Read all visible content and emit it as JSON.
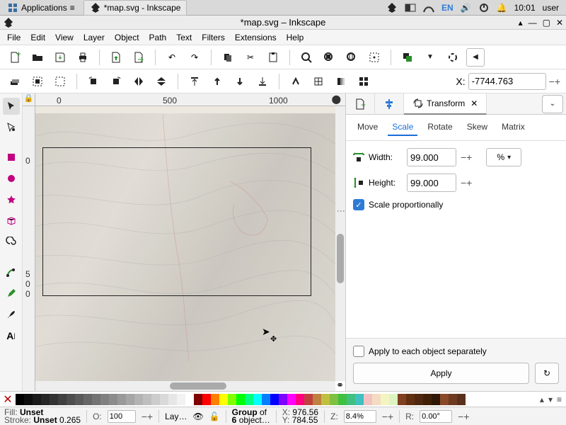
{
  "system": {
    "app_menu": "Applications",
    "taskbar_title": "*map.svg - Inkscape",
    "lang": "EN",
    "clock": "10:01",
    "user": "user"
  },
  "window": {
    "title": "*map.svg – Inkscape"
  },
  "menus": [
    "File",
    "Edit",
    "View",
    "Layer",
    "Object",
    "Path",
    "Text",
    "Filters",
    "Extensions",
    "Help"
  ],
  "coord": {
    "label": "X:",
    "value": "-7744.763"
  },
  "ruler_h": {
    "t0": "0",
    "t500": "500",
    "t1000": "1000"
  },
  "ruler_v": {
    "t0": "0",
    "t5": "5\n0\n0"
  },
  "dock": {
    "tab_transform": "Transform",
    "tabs": {
      "move": "Move",
      "scale": "Scale",
      "rotate": "Rotate",
      "skew": "Skew",
      "matrix": "Matrix"
    },
    "width_label": "Width:",
    "height_label": "Height:",
    "width_value": "99.000",
    "height_value": "99.000",
    "unit": "%",
    "scale_prop": "Scale proportionally",
    "apply_each": "Apply to each object separately",
    "apply": "Apply"
  },
  "status": {
    "fill_label": "Fill:",
    "stroke_label": "Stroke:",
    "unset": "Unset",
    "stroke_w": "0.265",
    "o_label": "O:",
    "opacity": "100",
    "layer_label": "Lay…",
    "sel1": "Group",
    "sel_of": "of",
    "sel2": "6",
    "sel_obj": "object…",
    "xl": "X:",
    "yl": "Y:",
    "xv": "976.56",
    "yv": "784.55",
    "zl": "Z:",
    "zv": "8.4%",
    "rl": "R:",
    "rv": "0.00°"
  },
  "palette_grays": [
    "#000",
    "#0d0d0d",
    "#1a1a1a",
    "#262626",
    "#333",
    "#404040",
    "#4d4d4d",
    "#595959",
    "#666",
    "#737373",
    "#808080",
    "#8c8c8c",
    "#999",
    "#a6a6a6",
    "#b3b3b3",
    "#bfbfbf",
    "#ccc",
    "#d9d9d9",
    "#e6e6e6",
    "#f2f2f2",
    "#fff"
  ],
  "palette_colors": [
    "#800000",
    "#f00",
    "#ff8000",
    "#ff0",
    "#80ff00",
    "#0f0",
    "#00ff80",
    "#0ff",
    "#0080ff",
    "#00f",
    "#8000ff",
    "#f0f",
    "#ff0080",
    "#c04040",
    "#c08040",
    "#c0c040",
    "#80c040",
    "#40c040",
    "#40c080",
    "#40c0c0",
    "#f4c2c2",
    "#f4dcc2",
    "#f4f4c2",
    "#dcf4c2",
    "#804020",
    "#603010",
    "#502810",
    "#402008",
    "#301806",
    "#8a4a2a",
    "#6e3b22",
    "#5a301c"
  ]
}
